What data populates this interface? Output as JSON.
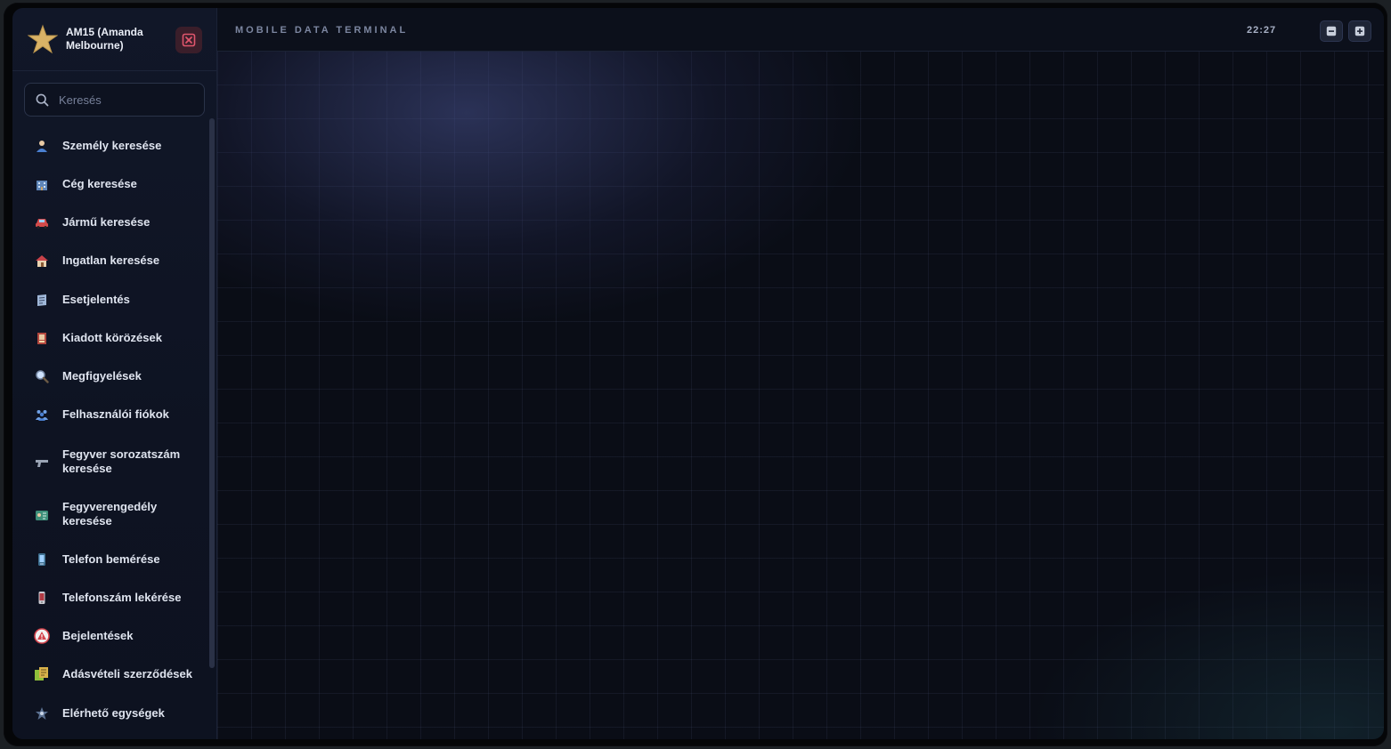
{
  "header": {
    "user_name": "AM15 (Amanda Melbourne)",
    "terminal_title": "MOBILE DATA TERMINAL",
    "clock": "22:27"
  },
  "search": {
    "placeholder": "Keresés"
  },
  "nav": {
    "items": [
      {
        "label": "Személy keresése",
        "icon": "person-icon"
      },
      {
        "label": "Cég keresése",
        "icon": "building-icon"
      },
      {
        "label": "Jármű keresése",
        "icon": "car-icon"
      },
      {
        "label": "Ingatlan keresése",
        "icon": "house-icon"
      },
      {
        "label": "Esetjelentés",
        "icon": "notepad-icon"
      },
      {
        "label": "Kiadott körözések",
        "icon": "wanted-poster-icon"
      },
      {
        "label": "Megfigyelések",
        "icon": "magnifier-icon"
      },
      {
        "label": "Felhasználói fiókok",
        "icon": "users-icon"
      },
      {
        "label": "Fegyver sorozatszám keresése",
        "icon": "gun-icon"
      },
      {
        "label": "Fegyverengedély keresése",
        "icon": "license-icon"
      },
      {
        "label": "Telefon bemérése",
        "icon": "phone-tower-icon"
      },
      {
        "label": "Telefonszám lekérése",
        "icon": "mobile-phone-icon"
      },
      {
        "label": "Bejelentések",
        "icon": "warning-icon"
      },
      {
        "label": "Adásvételi szerződések",
        "icon": "contract-icon"
      },
      {
        "label": "Elérhető egységek",
        "icon": "units-icon"
      }
    ]
  },
  "colors": {
    "accent_star": "#d9b266",
    "close_button": "#e0566d"
  }
}
